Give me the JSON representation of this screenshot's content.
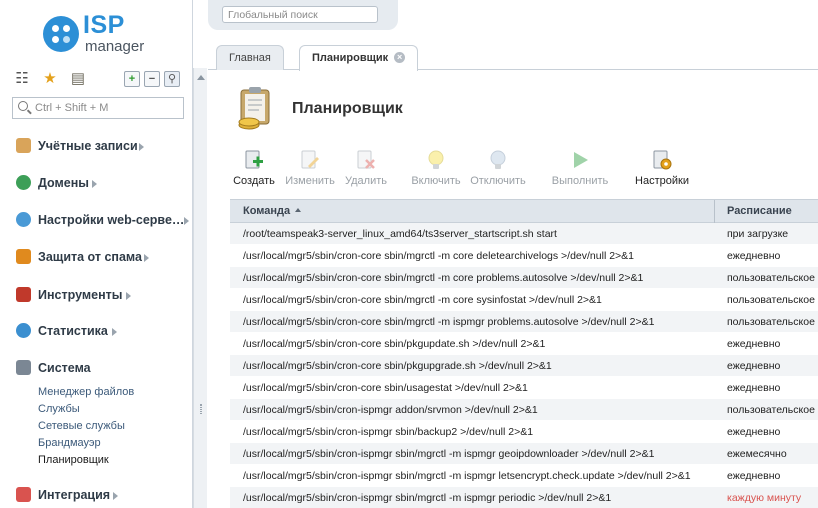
{
  "brand": {
    "line1": "ISP",
    "line2": "manager",
    "accent_color": "#2c8fd6"
  },
  "global_search": {
    "placeholder": "Глобальный поиск"
  },
  "sidebar": {
    "tools": [
      {
        "name": "tree-view-icon"
      },
      {
        "name": "favorites-star-icon"
      },
      {
        "name": "clipboard-icon"
      },
      {
        "name": "expand-all-icon",
        "glyph": "+"
      },
      {
        "name": "collapse-all-icon",
        "glyph": "−"
      },
      {
        "name": "pin-icon"
      }
    ],
    "search": {
      "placeholder": "Ctrl + Shift + M"
    },
    "groups": [
      {
        "label": "Учётные записи",
        "icon": "user-icon"
      },
      {
        "label": "Домены",
        "icon": "globe-icon"
      },
      {
        "label": "Настройки web-серве…",
        "icon": "web-settings-icon"
      },
      {
        "label": "Защита от спама",
        "icon": "shield-icon"
      },
      {
        "label": "Инструменты",
        "icon": "tools-icon"
      },
      {
        "label": "Статистика",
        "icon": "chart-icon"
      },
      {
        "label": "Система",
        "icon": "system-icon"
      },
      {
        "label": "Интеграция",
        "icon": "puzzle-icon"
      }
    ],
    "system_items": [
      "Менеджер файлов",
      "Службы",
      "Сетевые службы",
      "Брандмауэр",
      "Планировщик"
    ],
    "active_item": "Планировщик"
  },
  "tabs": [
    {
      "label": "Главная",
      "active": false
    },
    {
      "label": "Планировщик",
      "active": true
    }
  ],
  "page": {
    "title": "Планировщик"
  },
  "toolbar": [
    {
      "label": "Создать",
      "icon": "create-task-icon",
      "enabled": true
    },
    {
      "label": "Изменить",
      "icon": "edit-icon",
      "enabled": false
    },
    {
      "label": "Удалить",
      "icon": "delete-icon",
      "enabled": false
    },
    {
      "label": "Включить",
      "icon": "bulb-on-icon",
      "enabled": false
    },
    {
      "label": "Отключить",
      "icon": "bulb-off-icon",
      "enabled": false
    },
    {
      "label": "Выполнить",
      "icon": "run-icon",
      "enabled": false
    },
    {
      "label": "Настройки",
      "icon": "settings-icon",
      "enabled": true
    }
  ],
  "table": {
    "columns": [
      "Команда",
      "Расписание"
    ],
    "sorted_by": "Команда",
    "warn_color": "#d9534f",
    "rows": [
      {
        "command": "/root/teamspeak3-server_linux_amd64/ts3server_startscript.sh start",
        "schedule": "при загрузке",
        "warn": false
      },
      {
        "command": "/usr/local/mgr5/sbin/cron-core sbin/mgrctl -m core deletearchivelogs >/dev/null 2>&1",
        "schedule": "ежедневно",
        "warn": false
      },
      {
        "command": "/usr/local/mgr5/sbin/cron-core sbin/mgrctl -m core problems.autosolve >/dev/null 2>&1",
        "schedule": "пользовательское",
        "warn": false
      },
      {
        "command": "/usr/local/mgr5/sbin/cron-core sbin/mgrctl -m core sysinfostat >/dev/null 2>&1",
        "schedule": "пользовательское",
        "warn": false
      },
      {
        "command": "/usr/local/mgr5/sbin/cron-core sbin/mgrctl -m ispmgr problems.autosolve >/dev/null 2>&1",
        "schedule": "пользовательское",
        "warn": false
      },
      {
        "command": "/usr/local/mgr5/sbin/cron-core sbin/pkgupdate.sh >/dev/null 2>&1",
        "schedule": "ежедневно",
        "warn": false
      },
      {
        "command": "/usr/local/mgr5/sbin/cron-core sbin/pkgupgrade.sh >/dev/null 2>&1",
        "schedule": "ежедневно",
        "warn": false
      },
      {
        "command": "/usr/local/mgr5/sbin/cron-core sbin/usagestat >/dev/null 2>&1",
        "schedule": "ежедневно",
        "warn": false
      },
      {
        "command": "/usr/local/mgr5/sbin/cron-ispmgr addon/srvmon >/dev/null 2>&1",
        "schedule": "пользовательское",
        "warn": false
      },
      {
        "command": "/usr/local/mgr5/sbin/cron-ispmgr sbin/backup2 >/dev/null 2>&1",
        "schedule": "ежедневно",
        "warn": false
      },
      {
        "command": "/usr/local/mgr5/sbin/cron-ispmgr sbin/mgrctl -m ispmgr geoipdownloader >/dev/null 2>&1",
        "schedule": "ежемесячно",
        "warn": false
      },
      {
        "command": "/usr/local/mgr5/sbin/cron-ispmgr sbin/mgrctl -m ispmgr letsencrypt.check.update >/dev/null 2>&1",
        "schedule": "ежедневно",
        "warn": false
      },
      {
        "command": "/usr/local/mgr5/sbin/cron-ispmgr sbin/mgrctl -m ispmgr periodic >/dev/null 2>&1",
        "schedule": "каждую минуту",
        "warn": true
      }
    ]
  }
}
